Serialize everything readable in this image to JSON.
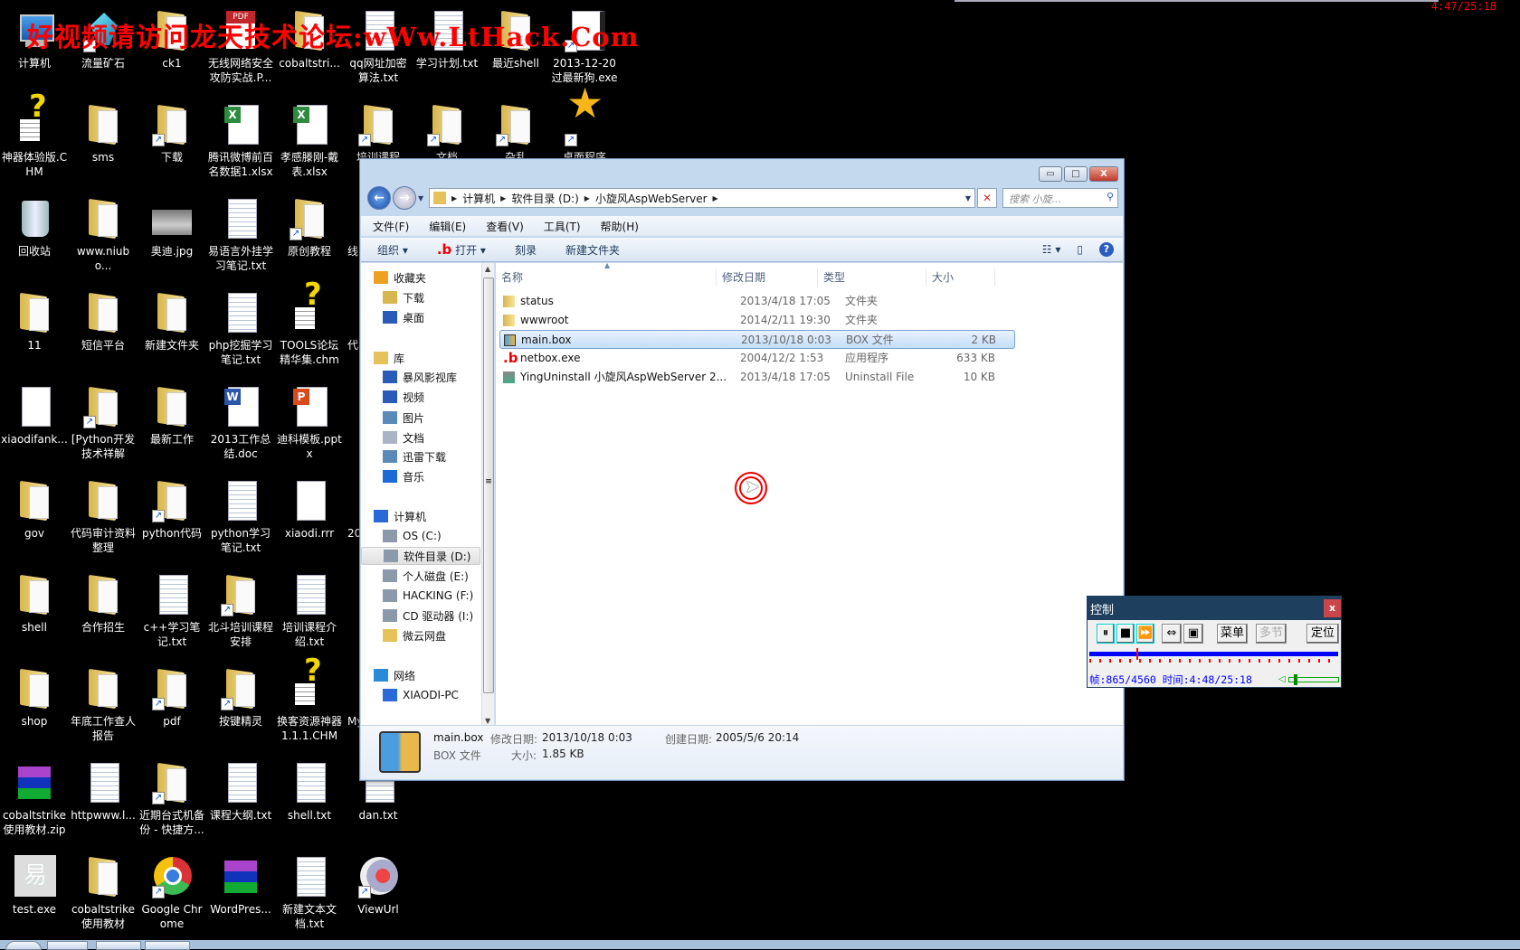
{
  "watermark": "好视频请访问龙天技术论坛:wWw.LtHack.Com",
  "recording_time": "4:47/25:18",
  "desktop": {
    "icons": [
      {
        "label": "计算机",
        "icon": "computer",
        "col": 0,
        "row": 0
      },
      {
        "label": "流量矿石",
        "icon": "gem",
        "col": 1,
        "row": 0,
        "shortcut": true
      },
      {
        "label": "ck1",
        "icon": "folder",
        "col": 2,
        "row": 0
      },
      {
        "label": "无线网络安全攻防实战.P...",
        "icon": "pdf",
        "col": 3,
        "row": 0
      },
      {
        "label": "cobaltstri...",
        "icon": "folder",
        "col": 4,
        "row": 0
      },
      {
        "label": "qq网址加密算法.txt",
        "icon": "txt",
        "col": 5,
        "row": 0
      },
      {
        "label": "学习计划.txt",
        "icon": "txt",
        "col": 6,
        "row": 0
      },
      {
        "label": "最近shell",
        "icon": "folder",
        "col": 7,
        "row": 0
      },
      {
        "label": "2013-12-20过最新狗.exe",
        "icon": "exe",
        "col": 8,
        "row": 0,
        "shortcut": true
      },
      {
        "label": "神器体验版.CHM",
        "icon": "chm",
        "col": 0,
        "row": 1
      },
      {
        "label": "sms",
        "icon": "folder",
        "col": 1,
        "row": 1
      },
      {
        "label": "下载",
        "icon": "folder",
        "col": 2,
        "row": 1,
        "shortcut": true
      },
      {
        "label": "腾讯微博前百名数据1.xlsx",
        "icon": "xlsx",
        "col": 3,
        "row": 1
      },
      {
        "label": "孝感滕刚-戴表.xlsx",
        "icon": "xlsx",
        "col": 4,
        "row": 1
      },
      {
        "label": "培训课程",
        "icon": "folder",
        "col": 5,
        "row": 1,
        "shortcut": true
      },
      {
        "label": "文档",
        "icon": "folder",
        "col": 6,
        "row": 1,
        "shortcut": true
      },
      {
        "label": "杂乱",
        "icon": "folder",
        "col": 7,
        "row": 1,
        "shortcut": true
      },
      {
        "label": "桌面程序",
        "icon": "star",
        "col": 8,
        "row": 1,
        "shortcut": true
      },
      {
        "label": "回收站",
        "icon": "recycle",
        "col": 0,
        "row": 2
      },
      {
        "label": "www.niubo...",
        "icon": "folder",
        "col": 1,
        "row": 2
      },
      {
        "label": "奥迪.jpg",
        "icon": "image",
        "col": 2,
        "row": 2
      },
      {
        "label": "易语言外挂学习笔记.txt",
        "icon": "txt",
        "col": 3,
        "row": 2
      },
      {
        "label": "原创教程",
        "icon": "folder",
        "col": 4,
        "row": 2,
        "shortcut": true
      },
      {
        "label": "线",
        "icon": "blank",
        "col": 5,
        "row": 2,
        "clip": true
      },
      {
        "label": "11",
        "icon": "folder",
        "col": 0,
        "row": 3
      },
      {
        "label": "短信平台",
        "icon": "folder",
        "col": 1,
        "row": 3
      },
      {
        "label": "新建文件夹",
        "icon": "folder",
        "col": 2,
        "row": 3
      },
      {
        "label": "php挖掘学习笔记.txt",
        "icon": "txt",
        "col": 3,
        "row": 3
      },
      {
        "label": "TOOLS论坛精华集.chm",
        "icon": "chm",
        "col": 4,
        "row": 3
      },
      {
        "label": "代",
        "icon": "blank",
        "col": 5,
        "row": 3,
        "clip": true
      },
      {
        "label": "xiaodifank...",
        "icon": "blank",
        "col": 0,
        "row": 4
      },
      {
        "label": "[Python开发技术祥解",
        "icon": "folder",
        "col": 1,
        "row": 4,
        "shortcut": true
      },
      {
        "label": "最新工作",
        "icon": "folder",
        "col": 2,
        "row": 4
      },
      {
        "label": "2013工作总结.doc",
        "icon": "doc",
        "col": 3,
        "row": 4
      },
      {
        "label": "迪科模板.pptx",
        "icon": "ppt",
        "col": 4,
        "row": 4
      },
      {
        "label": "gov",
        "icon": "folder",
        "col": 0,
        "row": 5
      },
      {
        "label": "代码审计资料整理",
        "icon": "folder",
        "col": 1,
        "row": 5
      },
      {
        "label": "python代码",
        "icon": "folder",
        "col": 2,
        "row": 5,
        "shortcut": true
      },
      {
        "label": "python学习笔记.txt",
        "icon": "txt",
        "col": 3,
        "row": 5
      },
      {
        "label": "xiaodi.rrr",
        "icon": "blank",
        "col": 4,
        "row": 5
      },
      {
        "label": "20",
        "icon": "blank",
        "col": 5,
        "row": 5,
        "clip": true
      },
      {
        "label": "shell",
        "icon": "folder",
        "col": 0,
        "row": 6
      },
      {
        "label": "合作招生",
        "icon": "folder",
        "col": 1,
        "row": 6
      },
      {
        "label": "c++学习笔记.txt",
        "icon": "txt",
        "col": 2,
        "row": 6
      },
      {
        "label": "北斗培训课程安排",
        "icon": "folder",
        "col": 3,
        "row": 6,
        "shortcut": true
      },
      {
        "label": "培训课程介绍.txt",
        "icon": "txt",
        "col": 4,
        "row": 6
      },
      {
        "label": "shop",
        "icon": "folder",
        "col": 0,
        "row": 7
      },
      {
        "label": "年底工作查人报告",
        "icon": "folder",
        "col": 1,
        "row": 7
      },
      {
        "label": "pdf",
        "icon": "folder",
        "col": 2,
        "row": 7,
        "shortcut": true
      },
      {
        "label": "按键精灵",
        "icon": "folder",
        "col": 3,
        "row": 7,
        "shortcut": true
      },
      {
        "label": "换客资源神器1.1.1.CHM",
        "icon": "chm",
        "col": 4,
        "row": 7
      },
      {
        "label": "My",
        "icon": "blank",
        "col": 5,
        "row": 7,
        "clip": true
      },
      {
        "label": "cobaltstrike使用教材.zip",
        "icon": "zip",
        "col": 0,
        "row": 8
      },
      {
        "label": "httpwww.l...",
        "icon": "txt",
        "col": 1,
        "row": 8
      },
      {
        "label": "近期台式机备份 - 快捷方...",
        "icon": "folder",
        "col": 2,
        "row": 8,
        "shortcut": true
      },
      {
        "label": "课程大纲.txt",
        "icon": "txt",
        "col": 3,
        "row": 8
      },
      {
        "label": "shell.txt",
        "icon": "txt",
        "col": 4,
        "row": 8
      },
      {
        "label": "dan.txt",
        "icon": "txt",
        "col": 5,
        "row": 8
      },
      {
        "label": "test.exe",
        "icon": "test",
        "col": 0,
        "row": 9
      },
      {
        "label": "cobaltstrike使用教材",
        "icon": "folder",
        "col": 1,
        "row": 9
      },
      {
        "label": "Google Chrome",
        "icon": "chrome",
        "col": 2,
        "row": 9,
        "shortcut": true
      },
      {
        "label": "WordPres...",
        "icon": "zip",
        "col": 3,
        "row": 9
      },
      {
        "label": "新建文本文档.txt",
        "icon": "txt",
        "col": 4,
        "row": 9
      },
      {
        "label": "ViewUrl",
        "icon": "viewurl",
        "col": 5,
        "row": 9,
        "shortcut": true
      }
    ]
  },
  "explorer": {
    "window_buttons": {
      "minimize": "▭",
      "maximize": "□",
      "close": "X"
    },
    "breadcrumb": [
      "计算机",
      "软件目录 (D:)",
      "小旋风AspWebServer"
    ],
    "search_placeholder": "搜索 小旋...",
    "menu": [
      "文件(F)",
      "编辑(E)",
      "查看(V)",
      "工具(T)",
      "帮助(H)"
    ],
    "toolbar": {
      "organize": "组织 ▾",
      "open": "打开 ▾",
      "burn": "刻录",
      "new_folder": "新建文件夹"
    },
    "nav": [
      {
        "label": "收藏夹",
        "icon": "star-icon",
        "color": "#f0a020"
      },
      {
        "label": "下载",
        "icon": "download-folder-icon",
        "color": "#d8b64e",
        "indent": true
      },
      {
        "label": "桌面",
        "icon": "desktop-icon",
        "color": "#2a5bb8",
        "indent": true
      },
      {
        "label": "库",
        "icon": "library-icon",
        "color": "#e6c35a"
      },
      {
        "label": "暴风影视库",
        "icon": "video-library-icon",
        "color": "#2a5bb8",
        "indent": true
      },
      {
        "label": "视频",
        "icon": "video-icon",
        "color": "#2a5bb8",
        "indent": true
      },
      {
        "label": "图片",
        "icon": "picture-icon",
        "color": "#5a8ab8",
        "indent": true
      },
      {
        "label": "文档",
        "icon": "document-icon",
        "color": "#aab4c4",
        "indent": true
      },
      {
        "label": "迅雷下载",
        "icon": "download-icon",
        "color": "#5a8ab8",
        "indent": true
      },
      {
        "label": "音乐",
        "icon": "music-icon",
        "color": "#1a6ad8",
        "indent": true
      },
      {
        "label": "计算机",
        "icon": "computer-icon",
        "color": "#2a6ad8"
      },
      {
        "label": "OS (C:)",
        "icon": "drive-icon",
        "color": "#8a9aaa",
        "indent": true
      },
      {
        "label": "软件目录 (D:)",
        "icon": "drive-icon",
        "color": "#8a9aaa",
        "indent": true,
        "selected": true
      },
      {
        "label": "个人磁盘 (E:)",
        "icon": "drive-icon",
        "color": "#8a9aaa",
        "indent": true
      },
      {
        "label": "HACKING (F:)",
        "icon": "drive-icon",
        "color": "#8a9aaa",
        "indent": true
      },
      {
        "label": "CD 驱动器 (I:)",
        "icon": "cd-drive-icon",
        "color": "#8a9aaa",
        "indent": true
      },
      {
        "label": "微云网盘",
        "icon": "folder-icon",
        "color": "#e6c35a",
        "indent": true
      },
      {
        "label": "网络",
        "icon": "network-icon",
        "color": "#2a8ad8"
      },
      {
        "label": "XIAODI-PC",
        "icon": "computer-icon",
        "color": "#2a6ad8",
        "indent": true
      }
    ],
    "columns": [
      "名称",
      "修改日期",
      "类型",
      "大小"
    ],
    "files": [
      {
        "name": "status",
        "modified": "2013/4/18 17:05",
        "type": "文件夹",
        "size": "",
        "icon": "folder"
      },
      {
        "name": "wwwroot",
        "modified": "2014/2/11 19:30",
        "type": "文件夹",
        "size": "",
        "icon": "folder"
      },
      {
        "name": "main.box",
        "modified": "2013/10/18 0:03",
        "type": "BOX 文件",
        "size": "2 KB",
        "icon": "box",
        "selected": true
      },
      {
        "name": "netbox.exe",
        "modified": "2004/12/2 1:53",
        "type": "应用程序",
        "size": "633 KB",
        "icon": "netbox"
      },
      {
        "name": "YingUninstall 小旋风AspWebServer 2...",
        "modified": "2013/4/18 17:05",
        "type": "Uninstall File",
        "size": "10 KB",
        "icon": "uninst"
      }
    ],
    "details": {
      "name": "main.box",
      "type": "BOX 文件",
      "modified_label": "修改日期:",
      "modified": "2013/10/18 0:03",
      "size_label": "大小:",
      "size": "1.85 KB",
      "created_label": "创建日期:",
      "created": "2005/5/6 20:14"
    }
  },
  "control": {
    "title": "控制",
    "close": "x",
    "buttons": {
      "pause": "⏸",
      "stop": "■",
      "fast_forward": "⏩",
      "fit": "⇔",
      "fullscreen": "▣",
      "menu": "菜单",
      "multi": "多节",
      "locate": "定位"
    },
    "status": "帧:865/4560 时间:4:48/25:18",
    "progress_fraction": 0.19,
    "volume_fraction": 0.1
  }
}
